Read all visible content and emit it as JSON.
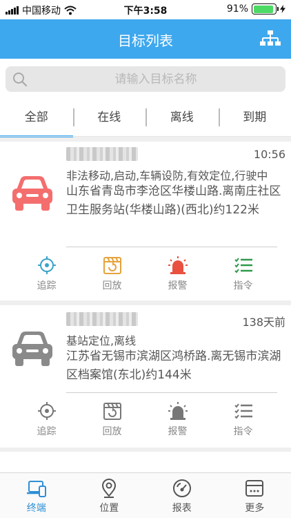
{
  "status_bar": {
    "carrier": "中国移动",
    "time": "下午3:58",
    "battery": "91%",
    "battery_level": 0.91
  },
  "nav": {
    "title": "目标列表",
    "right_icon": "org-tree-icon"
  },
  "search": {
    "placeholder": "请输入目标名称",
    "value": ""
  },
  "tabs": [
    {
      "label": "全部",
      "active": true
    },
    {
      "label": "在线",
      "active": false
    },
    {
      "label": "离线",
      "active": false
    },
    {
      "label": "到期",
      "active": false
    }
  ],
  "targets": [
    {
      "state": "online",
      "icon_color": "#f46e6e",
      "time": "10:56",
      "status": "非法移动,启动,车辆设防,有效定位,行驶中",
      "address": "山东省青岛市李沧区华楼山路.离南庄社区卫生服务站(华楼山路)(西北)约122米",
      "actions": [
        {
          "label": "追踪",
          "icon": "crosshair-icon"
        },
        {
          "label": "回放",
          "icon": "playback-icon"
        },
        {
          "label": "报警",
          "icon": "alarm-light-icon"
        },
        {
          "label": "指令",
          "icon": "command-list-icon"
        }
      ]
    },
    {
      "state": "offline",
      "icon_color": "#8a8a8a",
      "time": "138天前",
      "status": "基站定位,离线",
      "address": "江苏省无锡市滨湖区鸿桥路.离无锡市滨湖区档案馆(东北)约144米",
      "actions": [
        {
          "label": "追踪",
          "icon": "crosshair-icon"
        },
        {
          "label": "回放",
          "icon": "playback-icon"
        },
        {
          "label": "报警",
          "icon": "alarm-light-icon"
        },
        {
          "label": "指令",
          "icon": "command-list-icon"
        }
      ]
    }
  ],
  "tabbar": [
    {
      "label": "终端",
      "icon": "terminal-device-icon",
      "active": true
    },
    {
      "label": "位置",
      "icon": "location-pin-icon",
      "active": false
    },
    {
      "label": "报表",
      "icon": "dashboard-icon",
      "active": false
    },
    {
      "label": "更多",
      "icon": "more-card-icon",
      "active": false
    }
  ],
  "colors": {
    "brand": "#3ea8ee",
    "online_car": "#f46e6e",
    "offline_car": "#8a8a8a",
    "track_icon": "#3aa3c9",
    "playback_icon": "#e5a23a",
    "alarm_icon": "#e9503f",
    "command_icon": "#2f9a4b"
  }
}
